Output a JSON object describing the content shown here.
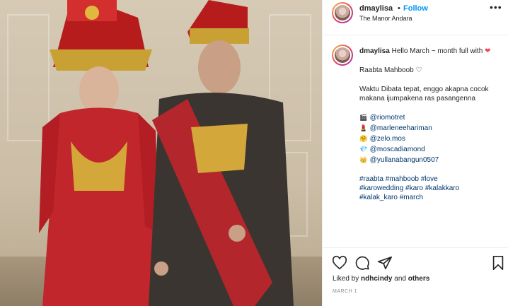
{
  "post": {
    "username": "dmaylisa",
    "follow_label": "Follow",
    "dot": "•",
    "location": "The Manor Andara",
    "more_icon": "more-horizontal-icon"
  },
  "caption": {
    "username": "dmaylisa",
    "line1": "Hello March ~ month full with",
    "heart": "❤",
    "line2": "Raabta Mahboob ♡",
    "line3": "Waktu Dibata tepat, enggo akapna cocok makana ijumpakena ras pasangenna",
    "credits": [
      {
        "emoji": "🎬",
        "handle": "@riomotret"
      },
      {
        "emoji": "💄",
        "handle": "@marleneehariman"
      },
      {
        "emoji": "🤗",
        "handle": "@zelo.mos"
      },
      {
        "emoji": "💎",
        "handle": "@moscadiamond"
      },
      {
        "emoji": "👑",
        "handle": "@yullanabangun0507"
      }
    ],
    "hashtags_line1": "#raabta #mahboob #love",
    "hashtags_line2": "#karowedding #karo #kalakkaro",
    "hashtags_line3": "#kalak_karo #march"
  },
  "actions": {
    "likes_prefix": "Liked by",
    "likes_user": "ndhcindy",
    "likes_and": "and",
    "likes_others": "others",
    "date": "MARCH 1"
  }
}
